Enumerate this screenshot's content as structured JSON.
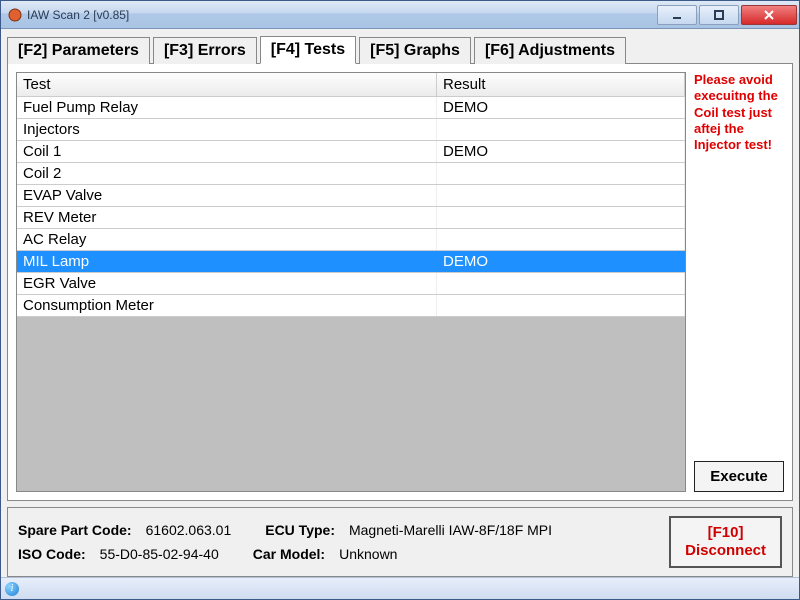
{
  "window": {
    "title": "IAW Scan 2 [v0.85]"
  },
  "tabs": [
    {
      "label": "[F2] Parameters"
    },
    {
      "label": "[F3] Errors"
    },
    {
      "label": "[F4] Tests"
    },
    {
      "label": "[F5] Graphs"
    },
    {
      "label": "[F6] Adjustments"
    }
  ],
  "active_tab": 2,
  "table": {
    "columns": [
      "Test",
      "Result"
    ],
    "rows": [
      {
        "test": "Fuel Pump Relay",
        "result": "DEMO",
        "selected": false
      },
      {
        "test": "Injectors",
        "result": "",
        "selected": false
      },
      {
        "test": "Coil 1",
        "result": "DEMO",
        "selected": false
      },
      {
        "test": "Coil 2",
        "result": "",
        "selected": false
      },
      {
        "test": "EVAP Valve",
        "result": "",
        "selected": false
      },
      {
        "test": "REV Meter",
        "result": "",
        "selected": false
      },
      {
        "test": "AC Relay",
        "result": "",
        "selected": false
      },
      {
        "test": "MIL Lamp",
        "result": "DEMO",
        "selected": true
      },
      {
        "test": "EGR Valve",
        "result": "",
        "selected": false
      },
      {
        "test": "Consumption Meter",
        "result": "",
        "selected": false
      }
    ]
  },
  "warning": "Please avoid execuitng the Coil test just aftej the Injector test!",
  "execute_label": "Execute",
  "status": {
    "spare_label": "Spare Part Code:",
    "spare_value": "61602.063.01",
    "ecu_label": "ECU Type:",
    "ecu_value": "Magneti-Marelli IAW-8F/18F MPI",
    "iso_label": "ISO Code:",
    "iso_value": "55-D0-85-02-94-40",
    "car_label": "Car Model:",
    "car_value": "Unknown"
  },
  "disconnect": {
    "line1": "[F10]",
    "line2": "Disconnect"
  }
}
